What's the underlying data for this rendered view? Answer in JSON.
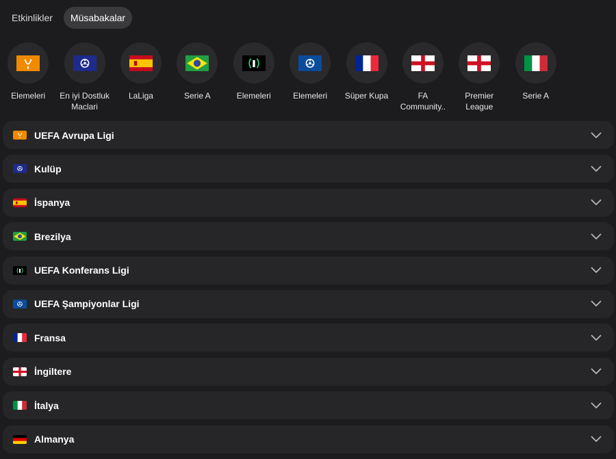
{
  "tabs": [
    {
      "label": "Etkinlikler",
      "active": false
    },
    {
      "label": "Müsabakalar",
      "active": true
    }
  ],
  "competitions": [
    {
      "label": "Elemeleri",
      "icon": "europa-league-logo-icon"
    },
    {
      "label": "En iyi Dostluk Maclari",
      "icon": "club-friendly-logo-icon"
    },
    {
      "label": "LaLiga",
      "icon": "spain-flag-icon"
    },
    {
      "label": "Serie A",
      "icon": "brazil-flag-icon"
    },
    {
      "label": "Elemeleri",
      "icon": "conference-league-logo-icon"
    },
    {
      "label": "Elemeleri",
      "icon": "champions-league-logo-icon"
    },
    {
      "label": "Süper Kupa",
      "icon": "france-flag-icon"
    },
    {
      "label": "FA Community..",
      "icon": "england-flag-icon"
    },
    {
      "label": "Premier League",
      "icon": "england-flag-icon"
    },
    {
      "label": "Serie A",
      "icon": "italy-flag-icon"
    }
  ],
  "categories": [
    {
      "label": "UEFA Avrupa Ligi",
      "icon": "europa-league-logo-icon"
    },
    {
      "label": "Kulüp",
      "icon": "club-friendly-logo-icon"
    },
    {
      "label": "İspanya",
      "icon": "spain-flag-icon"
    },
    {
      "label": "Brezilya",
      "icon": "brazil-flag-icon"
    },
    {
      "label": "UEFA Konferans Ligi",
      "icon": "conference-league-logo-icon"
    },
    {
      "label": "UEFA Şampiyonlar Ligi",
      "icon": "champions-league-logo-icon"
    },
    {
      "label": "Fransa",
      "icon": "france-flag-icon"
    },
    {
      "label": "İngiltere",
      "icon": "england-flag-icon"
    },
    {
      "label": "İtalya",
      "icon": "italy-flag-icon"
    },
    {
      "label": "Almanya",
      "icon": "germany-flag-icon"
    }
  ],
  "colors": {
    "background": "#1c1c1e",
    "row_background": "#262628",
    "active_tab": "#3a3a3c",
    "europa_orange": "#f08a00",
    "club_blue": "#1e2b8c",
    "ucl_blue": "#0b4c9a"
  }
}
